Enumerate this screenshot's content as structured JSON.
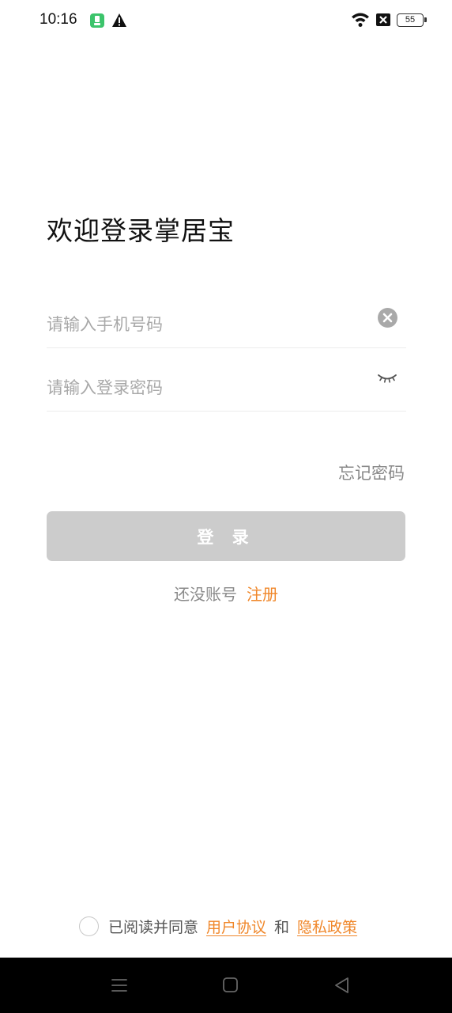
{
  "status_bar": {
    "time": "10:16",
    "battery": "55",
    "icons": [
      "app-notification-icon",
      "warning-icon",
      "wifi-icon",
      "no-sim-icon",
      "battery-icon"
    ]
  },
  "login": {
    "welcome_title": "欢迎登录掌居宝",
    "phone_placeholder": "请输入手机号码",
    "password_placeholder": "请输入登录密码",
    "forgot_password": "忘记密码",
    "login_button": "登 录",
    "no_account": "还没账号",
    "register": "注册"
  },
  "agreement": {
    "read_and_agree": "已阅读并同意",
    "user_agreement": "用户协议",
    "and": "和",
    "privacy_policy": "隐私政策"
  },
  "colors": {
    "accent": "#f0872a",
    "button_disabled": "#cccccc",
    "placeholder": "#a8a8a8",
    "nav_bar": "#000000"
  }
}
